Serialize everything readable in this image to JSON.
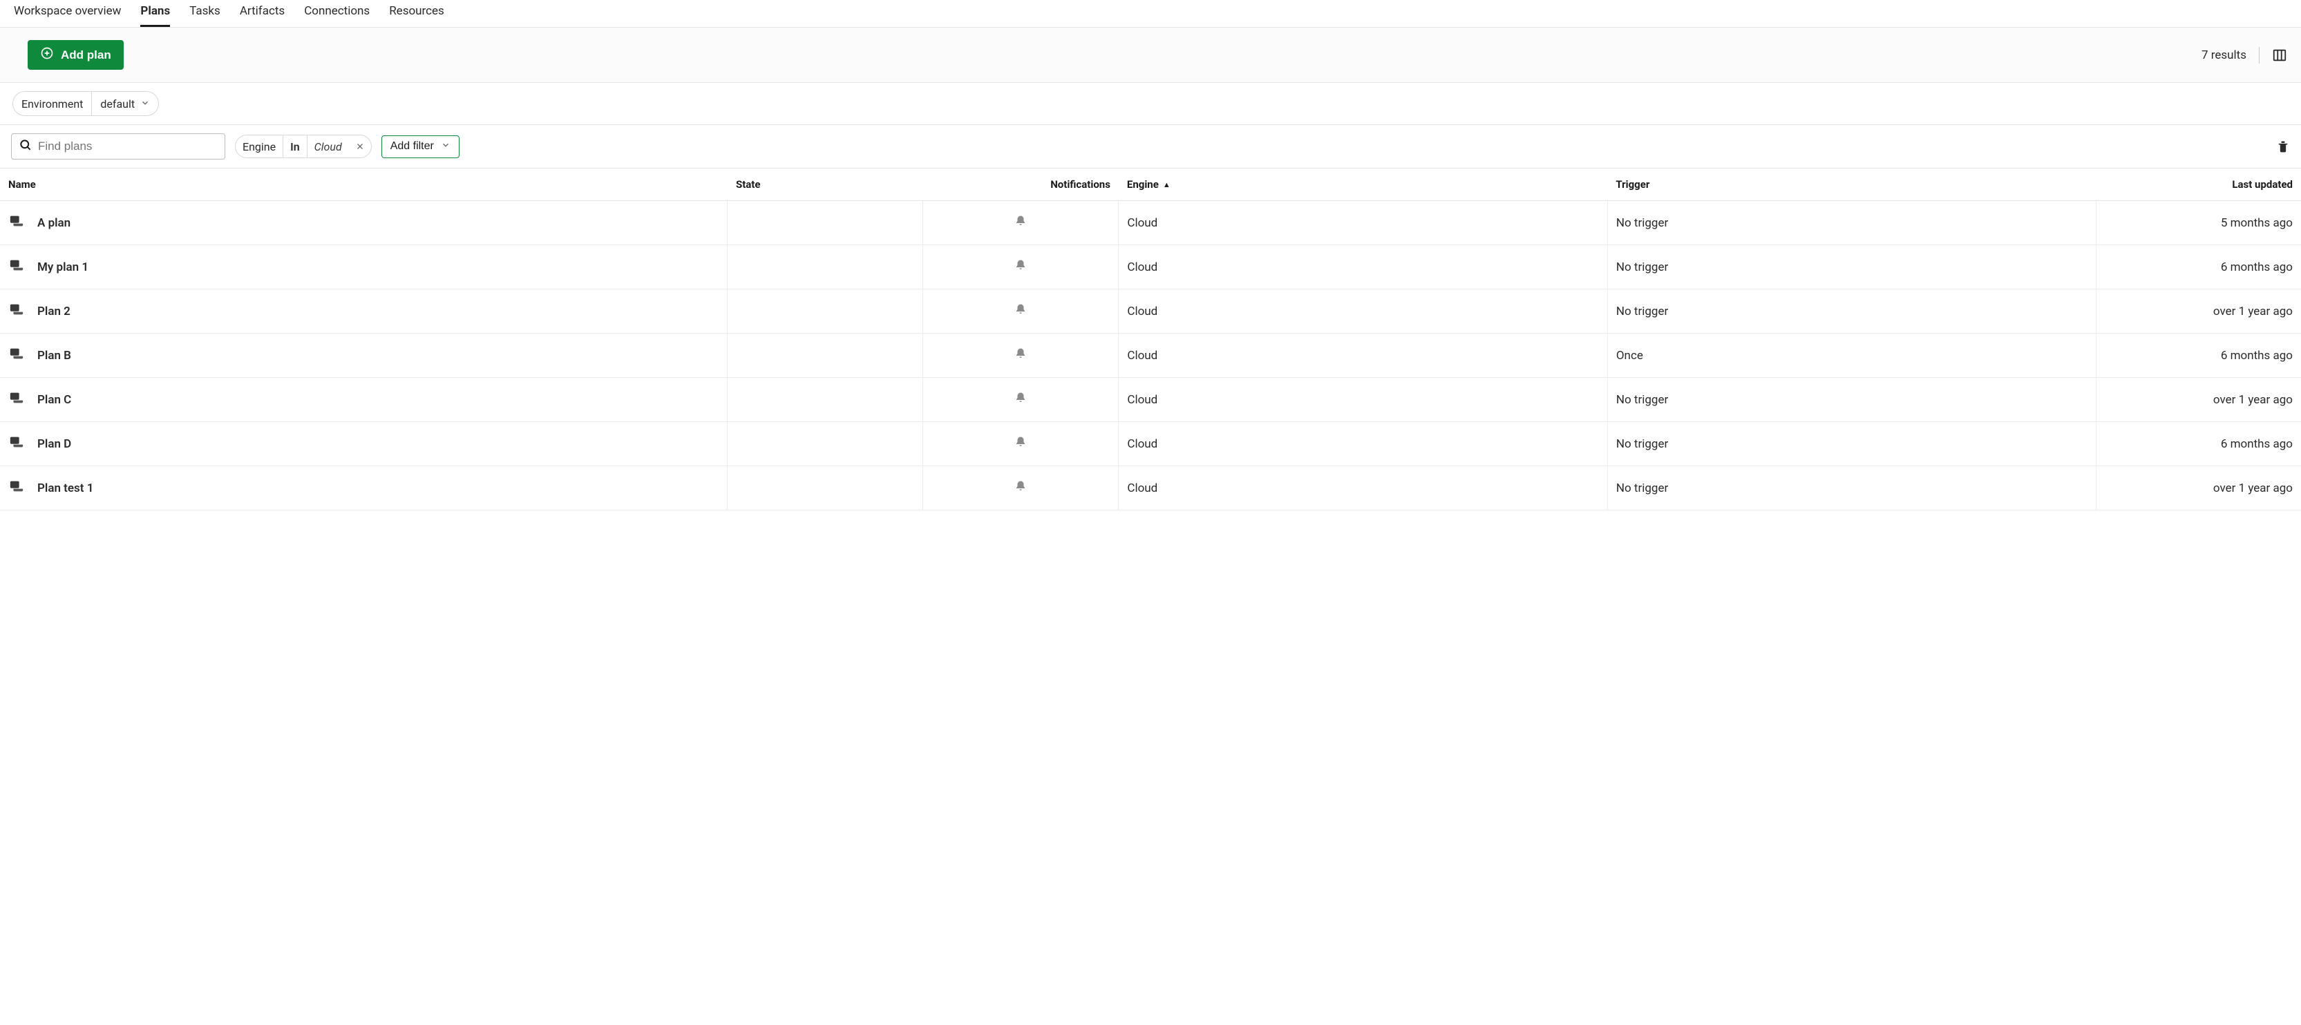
{
  "tabs": [
    {
      "label": "Workspace overview",
      "active": false
    },
    {
      "label": "Plans",
      "active": true
    },
    {
      "label": "Tasks",
      "active": false
    },
    {
      "label": "Artifacts",
      "active": false
    },
    {
      "label": "Connections",
      "active": false
    },
    {
      "label": "Resources",
      "active": false
    }
  ],
  "actionbar": {
    "add_plan_label": "Add plan",
    "results_label": "7 results"
  },
  "env": {
    "label": "Environment",
    "value": "default"
  },
  "search": {
    "placeholder": "Find plans"
  },
  "filter_chip": {
    "field": "Engine",
    "operator": "In",
    "value": "Cloud"
  },
  "add_filter_label": "Add filter",
  "columns": {
    "name": "Name",
    "state": "State",
    "notifications": "Notifications",
    "engine": "Engine",
    "trigger": "Trigger",
    "last_updated": "Last updated"
  },
  "sort": {
    "column": "engine",
    "direction": "asc"
  },
  "rows": [
    {
      "name": "A plan",
      "state": "",
      "engine": "Cloud",
      "trigger": "No trigger",
      "last_updated": "5 months ago"
    },
    {
      "name": "My plan 1",
      "state": "",
      "engine": "Cloud",
      "trigger": "No trigger",
      "last_updated": "6 months ago"
    },
    {
      "name": "Plan 2",
      "state": "",
      "engine": "Cloud",
      "trigger": "No trigger",
      "last_updated": "over 1 year ago"
    },
    {
      "name": "Plan B",
      "state": "",
      "engine": "Cloud",
      "trigger": "Once",
      "last_updated": "6 months ago"
    },
    {
      "name": "Plan C",
      "state": "",
      "engine": "Cloud",
      "trigger": "No trigger",
      "last_updated": "over 1 year ago"
    },
    {
      "name": "Plan D",
      "state": "",
      "engine": "Cloud",
      "trigger": "No trigger",
      "last_updated": "6 months ago"
    },
    {
      "name": "Plan test 1",
      "state": "",
      "engine": "Cloud",
      "trigger": "No trigger",
      "last_updated": "over 1 year ago"
    }
  ]
}
